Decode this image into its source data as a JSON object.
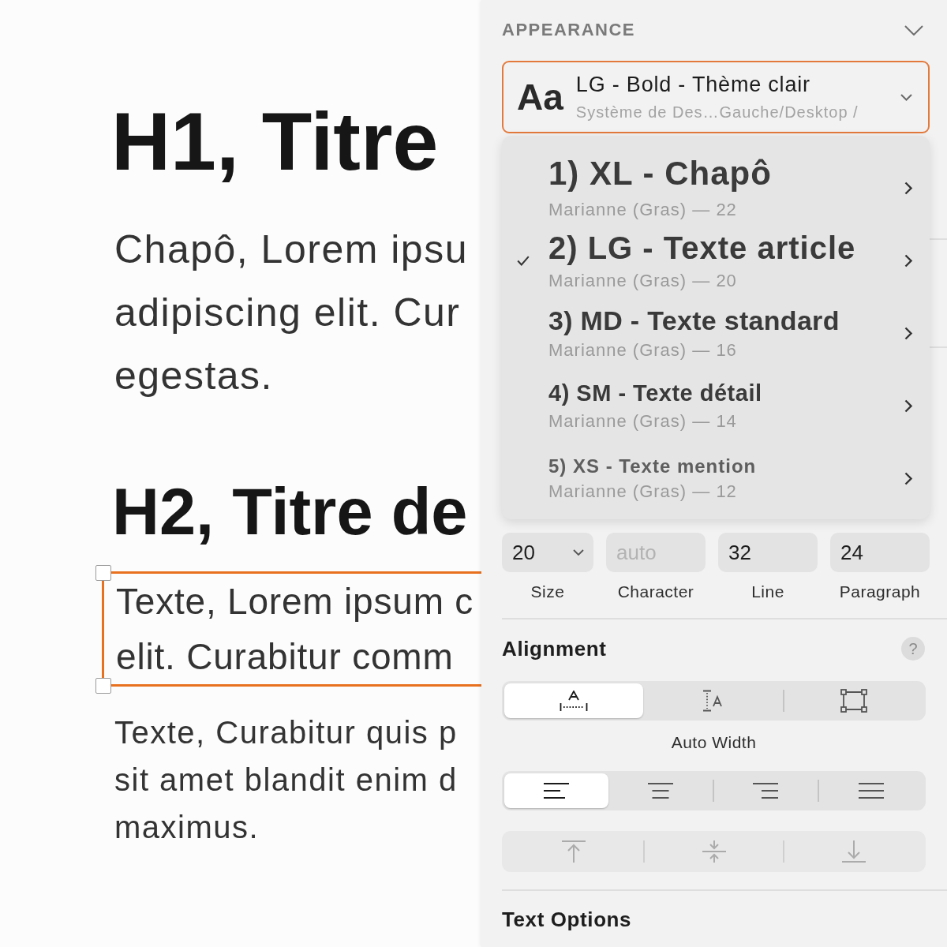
{
  "canvas": {
    "heading_1": "H1, Titre",
    "lead": [
      "Chapô, Lorem ipsu",
      "adipiscing elit. Cur",
      "egestas."
    ],
    "heading_2": "H2, Titre de",
    "selected_paragraph": {
      "selected": true,
      "lines": [
        "Texte, Lorem ipsum c",
        "elit. Curabitur comm"
      ]
    },
    "paragraph": [
      "Texte, Curabitur quis p",
      "sit amet blandit enim d",
      "maximus."
    ]
  },
  "inspector": {
    "section_title": "APPEARANCE",
    "style_picker": {
      "preview": "Aa",
      "title": "LG - Bold - Thème clair",
      "path": "Système de Des…Gauche/Desktop /",
      "open": true,
      "options": [
        {
          "name": "1) XL - Chapô",
          "font": "Marianne (Gras) — 22",
          "selected": false
        },
        {
          "name": "2) LG - Texte article",
          "font": "Marianne (Gras) — 20",
          "selected": true
        },
        {
          "name": "3) MD - Texte standard",
          "font": "Marianne (Gras) — 16",
          "selected": false
        },
        {
          "name": "4) SM - Texte détail",
          "font": "Marianne (Gras) — 14",
          "selected": false
        },
        {
          "name": "5) XS - Texte mention",
          "font": "Marianne (Gras) — 12",
          "selected": false
        }
      ]
    },
    "spacing": [
      {
        "kind": "dropdown",
        "value": "20",
        "label": "Size"
      },
      {
        "kind": "input",
        "placeholder": "auto",
        "label": "Character"
      },
      {
        "kind": "input",
        "value": "32",
        "label": "Line"
      },
      {
        "kind": "input",
        "value": "24",
        "label": "Paragraph"
      }
    ],
    "alignment": {
      "title": "Alignment",
      "help": "?",
      "resizing": [
        {
          "kind": "auto-width",
          "selected": true
        },
        {
          "kind": "auto-height",
          "selected": false
        },
        {
          "kind": "fixed-size",
          "selected": false
        }
      ],
      "resizing_caption": "Auto Width",
      "horizontal": [
        {
          "kind": "left",
          "selected": true
        },
        {
          "kind": "center",
          "selected": false
        },
        {
          "kind": "right",
          "selected": false
        },
        {
          "kind": "justify",
          "selected": false
        }
      ],
      "vertical": {
        "disabled": true,
        "options": [
          {
            "kind": "top"
          },
          {
            "kind": "middle"
          },
          {
            "kind": "bottom"
          }
        ]
      }
    },
    "text_options": {
      "title": "Text Options"
    }
  }
}
